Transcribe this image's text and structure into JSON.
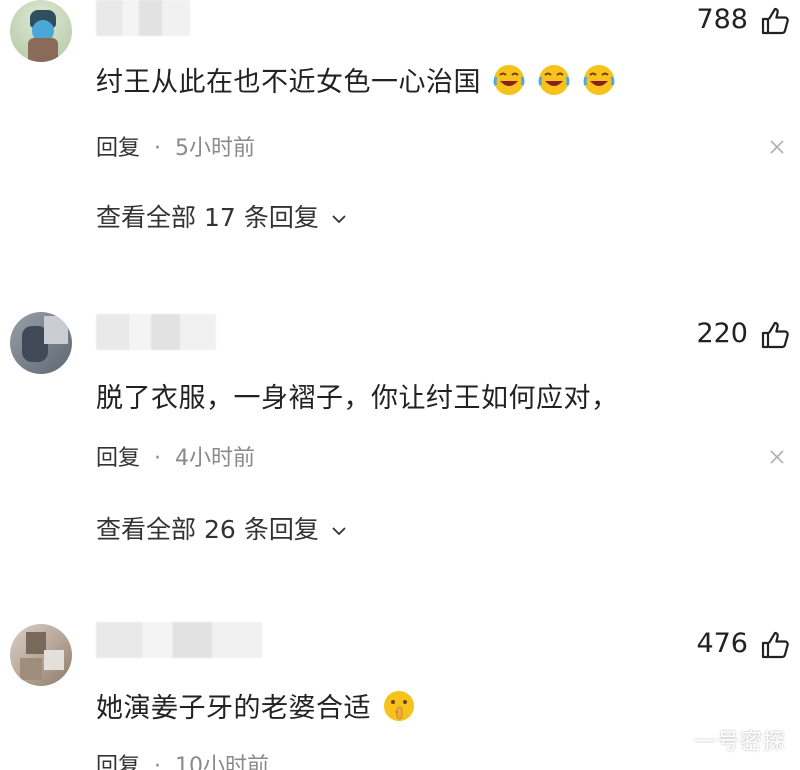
{
  "comments": [
    {
      "likes": "788",
      "text": "纣王从此在也不近女色一心治国",
      "emoji": [
        "face-with-tears-of-joy-emoji",
        "face-with-tears-of-joy-emoji",
        "face-with-tears-of-joy-emoji"
      ],
      "reply_label": "回复",
      "separator": "·",
      "time": "5小时前",
      "view_all": {
        "prefix": "查看全部",
        "count": "17",
        "suffix": "条回复"
      }
    },
    {
      "likes": "220",
      "text": "脱了衣服，一身褶子，你让纣王如何应对，",
      "emoji": [],
      "reply_label": "回复",
      "separator": "·",
      "time": "4小时前",
      "view_all": {
        "prefix": "查看全部",
        "count": "26",
        "suffix": "条回复"
      }
    },
    {
      "likes": "476",
      "text": "她演姜子牙的老婆合适",
      "emoji": [
        "shushing-face-emoji"
      ],
      "reply_label": "回复",
      "separator": "·",
      "time": "10小时前"
    }
  ],
  "icons": {
    "like": "thumbs-up-icon",
    "close": "close-icon",
    "expand": "chevron-down-icon"
  },
  "colors": {
    "text": "#222222",
    "meta": "#8a8a8a",
    "emoji_yellow": "#f7c21b"
  },
  "watermark": "一号密探"
}
